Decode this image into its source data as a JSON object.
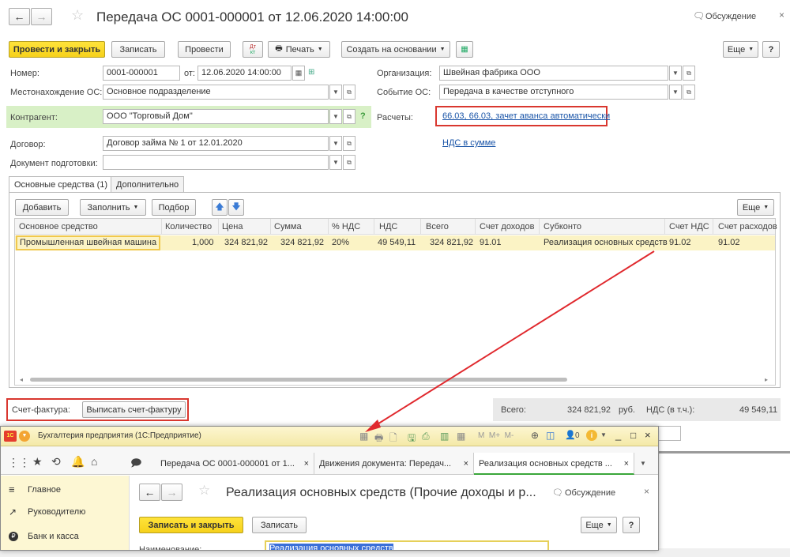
{
  "doc": {
    "title": "Передача ОС 0001-000001 от 12.06.2020 14:00:00",
    "discussion": "Обсуждение",
    "toolbar": {
      "post_close": "Провести и закрыть",
      "save": "Записать",
      "post": "Провести",
      "print": "Печать",
      "create_based": "Создать на основании",
      "more": "Еще",
      "help": "?",
      "dtkt_top": "Дт",
      "dtkt_bottom": "кт"
    },
    "fields": {
      "number_label": "Номер:",
      "number_value": "0001-000001",
      "date_label": "от:",
      "date_value": "12.06.2020 14:00:00",
      "org_label": "Организация:",
      "org_value": "Швейная фабрика ООО",
      "location_label": "Местонахождение ОС:",
      "location_value": "Основное подразделение",
      "event_label": "Событие ОС:",
      "event_value": "Передача в качестве отступного",
      "contractor_label": "Контрагент:",
      "contractor_value": "ООО \"Торговый Дом\"",
      "contractor_help": "?",
      "settlements_label": "Расчеты:",
      "settlements_link": "66.03, 66.03, зачет аванса автоматически",
      "contract_label": "Договор:",
      "contract_value": "Договор займа № 1 от 12.01.2020",
      "vat_link": "НДС в сумме",
      "prep_doc_label": "Документ подготовки:",
      "prep_doc_value": ""
    },
    "tabs": [
      "Основные средства (1)",
      "Дополнительно"
    ],
    "table_toolbar": {
      "add": "Добавить",
      "fill": "Заполнить",
      "select": "Подбор",
      "more": "Еще"
    },
    "table": {
      "columns": [
        "Основное средство",
        "Количество",
        "Цена",
        "Сумма",
        "% НДС",
        "НДС",
        "Всего",
        "Счет доходов",
        "Субконто",
        "Счет НДС",
        "Счет расходов"
      ],
      "rows": [
        [
          "Промышленная швейная машина",
          "1,000",
          "324 821,92",
          "324 821,92",
          "20%",
          "49 549,11",
          "324 821,92",
          "91.01",
          "Реализация основных средств",
          "91.02",
          "91.02"
        ]
      ]
    },
    "footer": {
      "invoice_label": "Счет-фактура:",
      "invoice_button": "Выписать счет-фактуру",
      "total_label": "Всего:",
      "total_value": "324 821,92",
      "currency": "руб.",
      "vat_label": "НДС (в т.ч.):",
      "vat_value": "49 549,11"
    }
  },
  "app": {
    "title": "Бухгалтерия предприятия (1С:Предприятие)",
    "logo": "1С",
    "calc_buttons": "M  M+  M-",
    "user_icon_text": "0",
    "tabs": [
      "Передача ОС 0001-000001 от 1...",
      "Движения документа: Передач...",
      "Реализация основных средств ..."
    ],
    "sidebar": [
      "Главное",
      "Руководителю",
      "Банк и касса"
    ],
    "subdoc": {
      "title": "Реализация основных средств (Прочие доходы и р...",
      "discussion": "Обсуждение",
      "save_close": "Записать и закрыть",
      "save": "Записать",
      "more": "Еще",
      "help": "?",
      "name_label": "Наименование:",
      "name_value": "Реализация основных средств"
    }
  },
  "colors": {
    "accent_yellow": "#f6d11b",
    "highlight_row": "#fbf3c5",
    "contractor_bg": "#d8f0c6",
    "link": "#1a55a8",
    "annotation_red": "#d9372f"
  }
}
